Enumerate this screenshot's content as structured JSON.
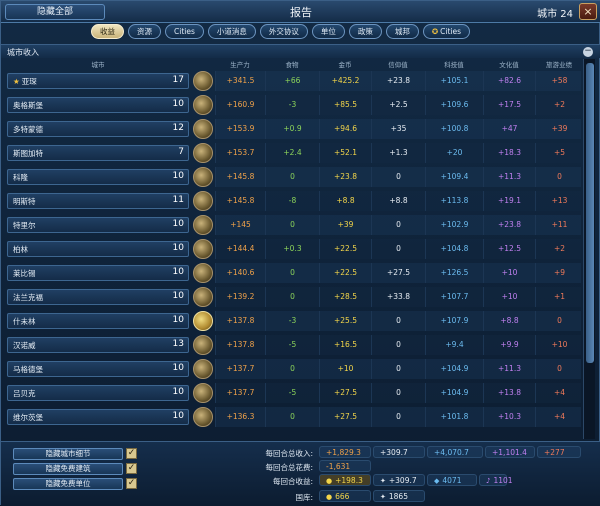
{
  "window": {
    "hide_all": "隐藏全部",
    "title": "报告",
    "city_count": "城市 24",
    "close": "×"
  },
  "tabs": [
    {
      "label": "收益",
      "active": true
    },
    {
      "label": "资源"
    },
    {
      "label": "Cities"
    },
    {
      "label": "小道消息"
    },
    {
      "label": "外交协议"
    },
    {
      "label": "单位"
    },
    {
      "label": "政策"
    },
    {
      "label": "城邦"
    },
    {
      "label": "Cities",
      "icon": "star-icon"
    }
  ],
  "section": {
    "title": "城市收入",
    "collapse": "−"
  },
  "columns": {
    "city": "城市",
    "production": "生产力",
    "food": "食物",
    "gold": "金币",
    "faith": "信仰值",
    "science": "科技值",
    "culture": "文化值",
    "tourism": "旅游业绩"
  },
  "rows": [
    {
      "name": "亚琛",
      "capital": true,
      "pop": "17",
      "prod": "+341.5",
      "food": "+66",
      "gold": "+425.2",
      "faith": "+23.8",
      "sci": "+105.1",
      "cult": "+82.6",
      "tour": "+58",
      "focus_selected": false
    },
    {
      "name": "奥格斯堡",
      "pop": "10",
      "prod": "+160.9",
      "food": "-3",
      "gold": "+85.5",
      "faith": "+2.5",
      "sci": "+109.6",
      "cult": "+17.5",
      "tour": "+2",
      "focus_selected": false
    },
    {
      "name": "多特蒙德",
      "pop": "12",
      "prod": "+153.9",
      "food": "+0.9",
      "gold": "+94.6",
      "faith": "+35",
      "sci": "+100.8",
      "cult": "+47",
      "tour": "+39",
      "focus_selected": false
    },
    {
      "name": "斯图加特",
      "pop": "7",
      "prod": "+153.7",
      "food": "+2.4",
      "gold": "+52.1",
      "faith": "+1.3",
      "sci": "+20",
      "cult": "+18.3",
      "tour": "+5",
      "focus_selected": false
    },
    {
      "name": "科隆",
      "pop": "10",
      "prod": "+145.8",
      "food": "0",
      "gold": "+23.8",
      "faith": "0",
      "sci": "+109.4",
      "cult": "+11.3",
      "tour": "0",
      "focus_selected": false
    },
    {
      "name": "明斯特",
      "pop": "11",
      "prod": "+145.8",
      "food": "-8",
      "gold": "+8.8",
      "faith": "+8.8",
      "sci": "+113.8",
      "cult": "+19.1",
      "tour": "+13",
      "focus_selected": false
    },
    {
      "name": "特里尔",
      "pop": "10",
      "prod": "+145",
      "food": "0",
      "gold": "+39",
      "faith": "0",
      "sci": "+102.9",
      "cult": "+23.8",
      "tour": "+11",
      "focus_selected": false
    },
    {
      "name": "柏林",
      "pop": "10",
      "prod": "+144.4",
      "food": "+0.3",
      "gold": "+22.5",
      "faith": "0",
      "sci": "+104.8",
      "cult": "+12.5",
      "tour": "+2",
      "focus_selected": false
    },
    {
      "name": "莱比锡",
      "pop": "10",
      "prod": "+140.6",
      "food": "0",
      "gold": "+22.5",
      "faith": "+27.5",
      "sci": "+126.5",
      "cult": "+10",
      "tour": "+9",
      "focus_selected": false
    },
    {
      "name": "法兰克福",
      "pop": "10",
      "prod": "+139.2",
      "food": "0",
      "gold": "+28.5",
      "faith": "+33.8",
      "sci": "+107.7",
      "cult": "+10",
      "tour": "+1",
      "focus_selected": false
    },
    {
      "name": "什未林",
      "pop": "10",
      "prod": "+137.8",
      "food": "-3",
      "gold": "+25.5",
      "faith": "0",
      "sci": "+107.9",
      "cult": "+8.8",
      "tour": "0",
      "focus_selected": true
    },
    {
      "name": "汉诺威",
      "pop": "13",
      "prod": "+137.8",
      "food": "-5",
      "gold": "+16.5",
      "faith": "0",
      "sci": "+9.4",
      "cult": "+9.9",
      "tour": "+10",
      "focus_selected": false
    },
    {
      "name": "马格德堡",
      "pop": "10",
      "prod": "+137.7",
      "food": "0",
      "gold": "+10",
      "faith": "0",
      "sci": "+104.9",
      "cult": "+11.3",
      "tour": "0",
      "focus_selected": false
    },
    {
      "name": "吕贝克",
      "pop": "10",
      "prod": "+137.7",
      "food": "-5",
      "gold": "+27.5",
      "faith": "0",
      "sci": "+104.9",
      "cult": "+13.8",
      "tour": "+4",
      "focus_selected": false
    },
    {
      "name": "维尔茨堡",
      "pop": "10",
      "prod": "+136.3",
      "food": "0",
      "gold": "+27.5",
      "faith": "0",
      "sci": "+101.8",
      "cult": "+10.3",
      "tour": "+4",
      "focus_selected": false
    }
  ],
  "options": [
    {
      "label": "隐藏城市细节",
      "checked": "✓"
    },
    {
      "label": "隐藏免费建筑",
      "checked": "✓"
    },
    {
      "label": "隐藏免费单位",
      "checked": "✓"
    }
  ],
  "summary": {
    "income_label": "每回合总收入:",
    "cost_label": "每回合总花费:",
    "net_label": "每回合收益:",
    "treasury_label": "国库:",
    "income": {
      "prod": "+1,829.3",
      "gold": "+309.7",
      "sci": "+4,070.7",
      "cult": "+1,101.4",
      "tour": "+277"
    },
    "cost": {
      "prod": "-1,631"
    },
    "net": {
      "gold": "+198.3",
      "faith": "+309.7",
      "sci": "4071",
      "cult": "1101"
    },
    "treasury": {
      "gold": "666",
      "faith": "1865"
    }
  },
  "colors": {
    "production": "#f0a24a",
    "food": "#8cd45a",
    "gold": "#f3d64a",
    "science": "#6cbcf0",
    "culture": "#c080f0",
    "tourism": "#f07a5a"
  }
}
